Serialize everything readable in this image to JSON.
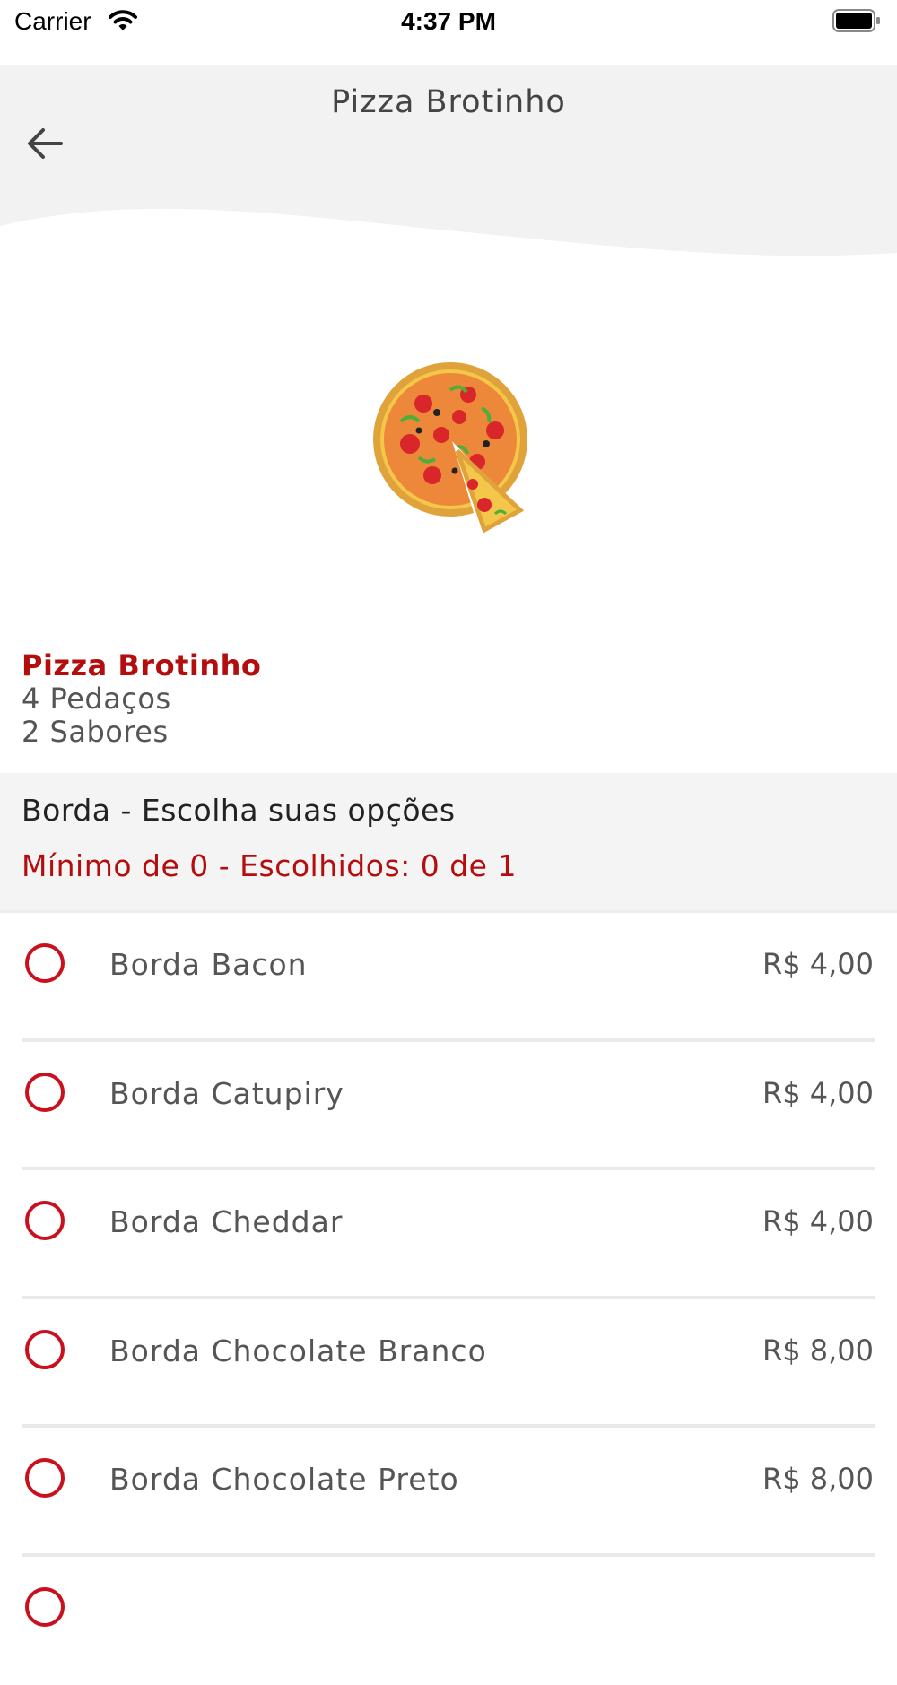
{
  "status_bar": {
    "carrier": "Carrier",
    "time": "4:37 PM"
  },
  "header": {
    "title": "Pizza Brotinho"
  },
  "product": {
    "name": "Pizza Brotinho",
    "pieces": "4 Pedaços",
    "flavors": "2 Sabores"
  },
  "group": {
    "title": "Borda - Escolha suas opções",
    "rule": "Mínimo de 0 - Escolhidos: 0 de 1"
  },
  "options": [
    {
      "label": "Borda Bacon",
      "price": "R$ 4,00"
    },
    {
      "label": "Borda Catupiry",
      "price": "R$ 4,00"
    },
    {
      "label": "Borda Cheddar",
      "price": "R$ 4,00"
    },
    {
      "label": "Borda Chocolate Branco",
      "price": "R$ 8,00"
    },
    {
      "label": "Borda Chocolate Preto",
      "price": "R$ 8,00"
    },
    {
      "label": "",
      "price": ""
    }
  ],
  "colors": {
    "accent": "#c8101e",
    "header_bg": "#f2f2f2"
  },
  "icons": {
    "back": "arrow-left-icon",
    "wifi": "wifi-icon",
    "battery": "battery-icon",
    "radio": "radio-unchecked-icon"
  }
}
